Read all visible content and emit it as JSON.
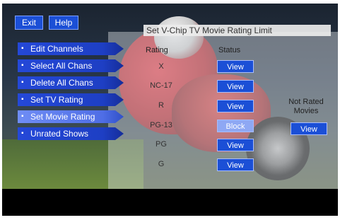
{
  "top_buttons": {
    "exit": "Exit",
    "help": "Help"
  },
  "menu": [
    {
      "label": "Edit Channels"
    },
    {
      "label": "Select All Chans"
    },
    {
      "label": "Delete All Chans"
    },
    {
      "label": "Set TV Rating"
    },
    {
      "label": "Set Movie Rating",
      "active": true
    },
    {
      "label": "Unrated Shows"
    }
  ],
  "panel": {
    "title": "Set V-Chip TV Movie Rating Limit",
    "rating_header": "Rating",
    "status_header": "Status",
    "rows": [
      {
        "rating": "X",
        "status": "View"
      },
      {
        "rating": "NC-17",
        "status": "View"
      },
      {
        "rating": "R",
        "status": "View"
      },
      {
        "rating": "PG-13",
        "status": "Block"
      },
      {
        "rating": "PG",
        "status": "View"
      },
      {
        "rating": "G",
        "status": "View"
      }
    ],
    "not_rated": {
      "label_line1": "Not Rated",
      "label_line2": "Movies",
      "status": "View"
    }
  },
  "colors": {
    "button_blue": "#1b4fd6",
    "active_blue": "#8ea8f4"
  }
}
